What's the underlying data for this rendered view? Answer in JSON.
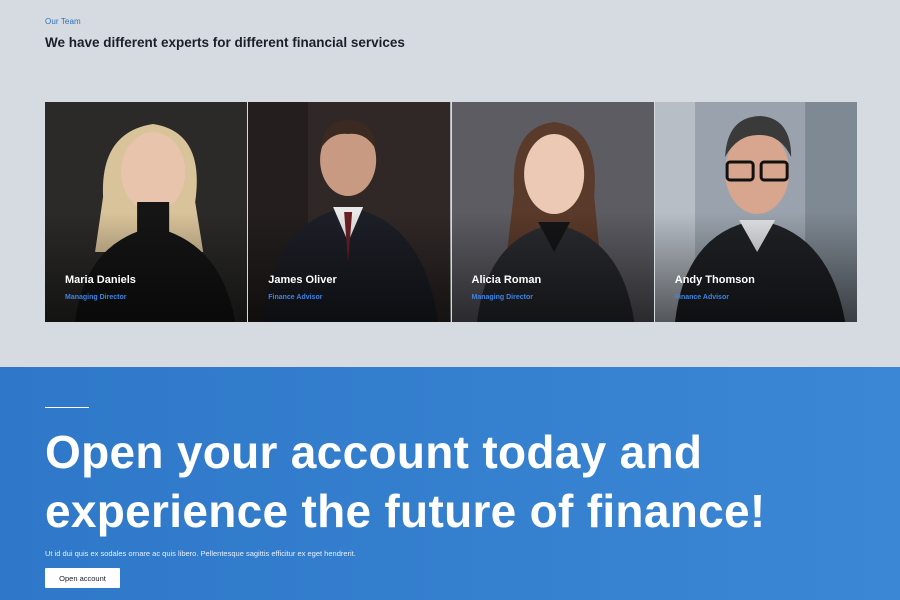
{
  "team": {
    "eyebrow": "Our Team",
    "title": "We have different experts for different financial services",
    "members": [
      {
        "name": "Maria Daniels",
        "role": "Managing Director",
        "photo_bg": "#2b2a29",
        "hair": "#d9c39a",
        "suit": "#151515",
        "skin": "#e8c4ad"
      },
      {
        "name": "James Oliver",
        "role": "Finance Advisor",
        "photo_bg": "#302827",
        "hair": "#3a2a22",
        "suit": "#1d1f27",
        "skin": "#c99a82"
      },
      {
        "name": "Alicia Roman",
        "role": "Managing Director",
        "photo_bg": "#5d5c63",
        "hair": "#5a3a2a",
        "suit": "#2a2b30",
        "skin": "#ecc9b4"
      },
      {
        "name": "Andy Thomson",
        "role": "Finance Advisor",
        "photo_bg": "#9aa3ad",
        "hair": "#3a3a3a",
        "suit": "#1f2226",
        "skin": "#d8a58e"
      }
    ]
  },
  "cta": {
    "headline_line1": "Open your account today and",
    "headline_line2": "experience the future of finance!",
    "subtext": "Ut id dui quis ex sodales ornare ac quis libero. Pellentesque sagittis efficitur ex eget hendrerit.",
    "button_label": "Open account"
  },
  "colors": {
    "accent": "#3b84e6",
    "cta_bg": "#3380cf",
    "page_bg": "#d5dbe0"
  }
}
